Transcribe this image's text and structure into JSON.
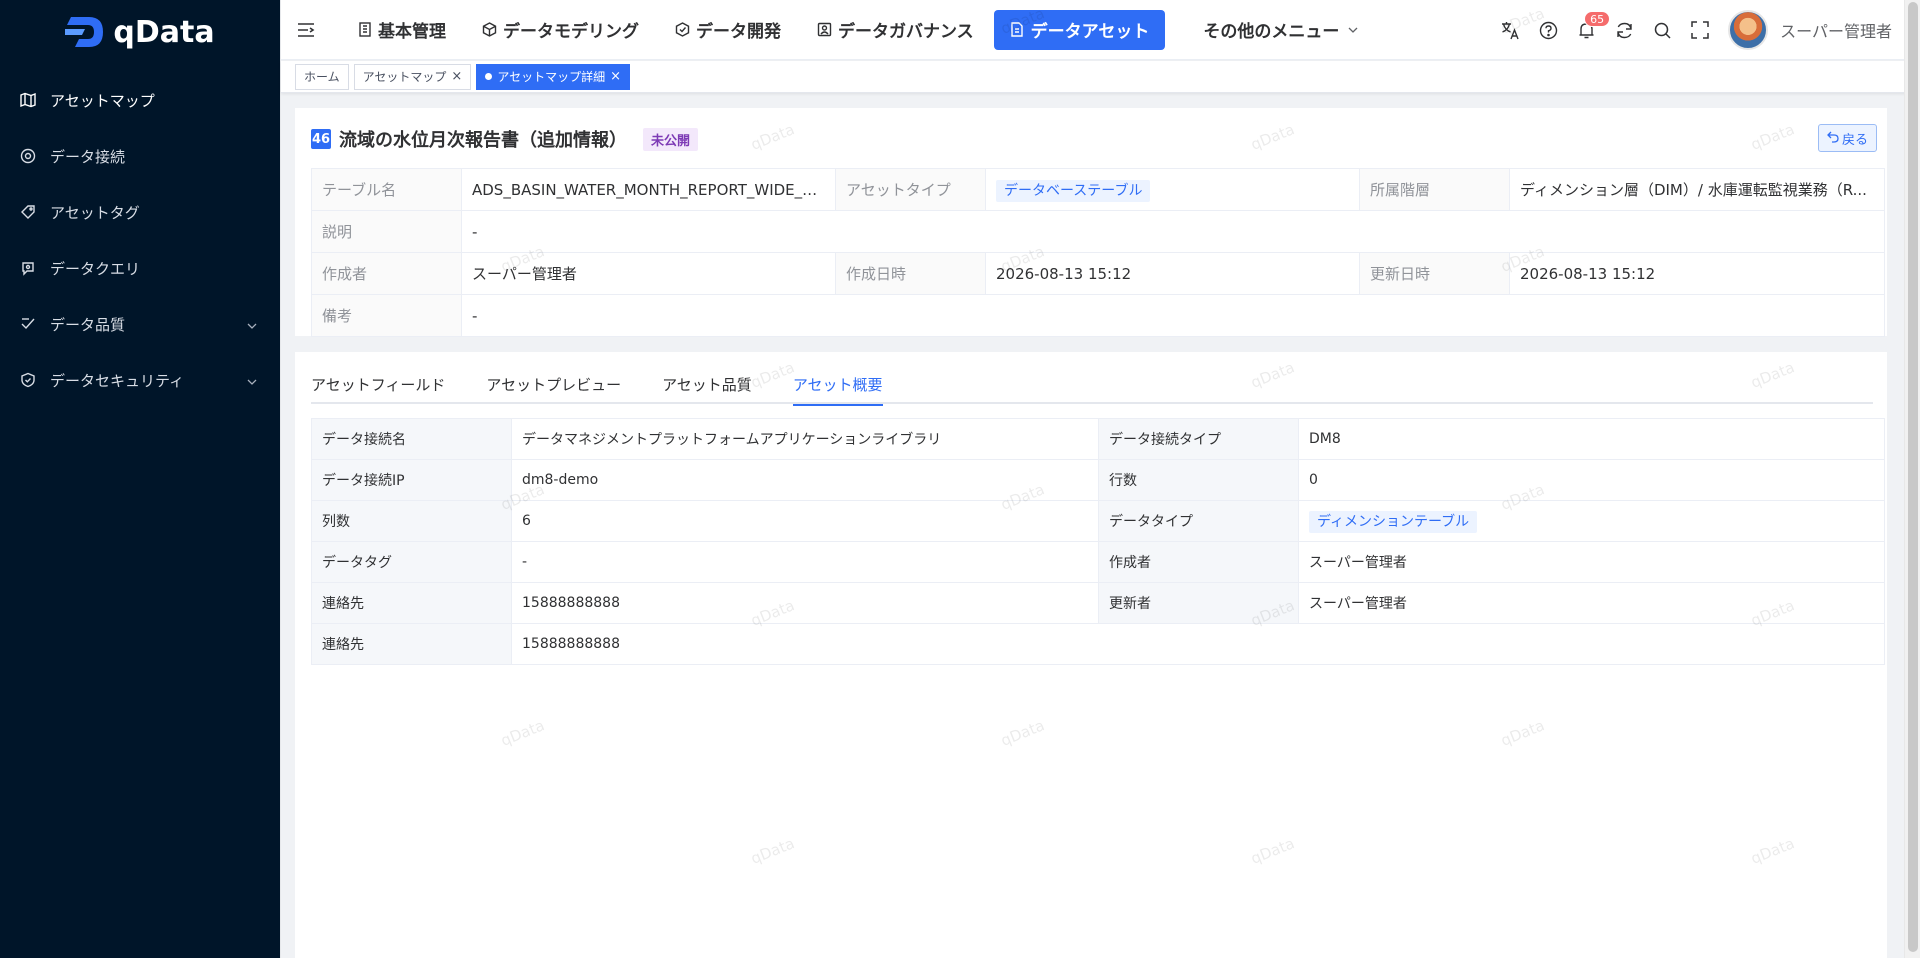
{
  "app": {
    "logo_text": "qData",
    "watermark": "qData"
  },
  "sidebar": {
    "items": [
      {
        "label": "アセットマップ",
        "icon": "map-icon",
        "active": true
      },
      {
        "label": "データ接続",
        "icon": "connection-icon"
      },
      {
        "label": "アセットタグ",
        "icon": "tag-icon"
      },
      {
        "label": "データクエリ",
        "icon": "query-icon"
      },
      {
        "label": "データ品質",
        "icon": "quality-icon",
        "expandable": true
      },
      {
        "label": "データセキュリティ",
        "icon": "shield-icon",
        "expandable": true
      }
    ]
  },
  "header": {
    "nav": [
      {
        "label": "基本管理",
        "icon": "building-icon"
      },
      {
        "label": "データモデリング",
        "icon": "cube-icon"
      },
      {
        "label": "データ開発",
        "icon": "hexagon-icon"
      },
      {
        "label": "データガバナンス",
        "icon": "governance-icon"
      },
      {
        "label": "データアセット",
        "icon": "asset-icon",
        "active": true
      },
      {
        "label": "その他のメニュー",
        "icon": "chevron-down-icon"
      }
    ],
    "notification_count": "65",
    "username": "スーパー管理者"
  },
  "tags_view": {
    "tags": [
      {
        "label": "ホーム"
      },
      {
        "label": "アセットマップ",
        "closable": true
      },
      {
        "label": "アセットマップ詳細",
        "closable": true,
        "active": true
      }
    ]
  },
  "asset": {
    "number": "46",
    "title": "流域の水位月次報告書（追加情報）",
    "status": "未公開",
    "back_label": "戻る",
    "fields": {
      "table_name_label": "テーブル名",
      "table_name": "ADS_BASIN_WATER_MONTH_REPORT_WIDE_A...",
      "asset_type_label": "アセットタイプ",
      "asset_type": "データベーステーブル",
      "layer_label": "所属階層",
      "layer": "ディメンション層（DIM）/ 水庫運転監視業務（R...",
      "description_label": "説明",
      "description": "-",
      "creator_label": "作成者",
      "creator": "スーパー管理者",
      "created_label": "作成日時",
      "created": "2026-08-13 15:12",
      "updated_label": "更新日時",
      "updated": "2026-08-13 15:12",
      "remarks_label": "備考",
      "remarks": "-"
    }
  },
  "tabs": [
    {
      "label": "アセットフィールド"
    },
    {
      "label": "アセットプレビュー"
    },
    {
      "label": "アセット品質"
    },
    {
      "label": "アセット概要",
      "active": true
    }
  ],
  "overview": {
    "rows": [
      {
        "l1": "データ接続名",
        "v1": "データマネジメントプラットフォームアプリケーションライブラリ",
        "l2": "データ接続タイプ",
        "v2": "DM8"
      },
      {
        "l1": "データ接続IP",
        "v1": "dm8-demo",
        "l2": "行数",
        "v2": "0"
      },
      {
        "l1": "列数",
        "v1": "6",
        "l2": "データタイプ",
        "v2": "ディメンションテーブル"
      },
      {
        "l1": "データタグ",
        "v1": "-",
        "l2": "作成者",
        "v2": "スーパー管理者"
      },
      {
        "l1": "連絡先",
        "v1": "15888888888",
        "l2": "更新者",
        "v2": "スーパー管理者"
      },
      {
        "l1": "連絡先",
        "v1": "15888888888"
      }
    ]
  },
  "colors": {
    "sidebar_bg": "#001529",
    "accent": "#2f6df5",
    "status_purple": "#7d3ab5"
  }
}
